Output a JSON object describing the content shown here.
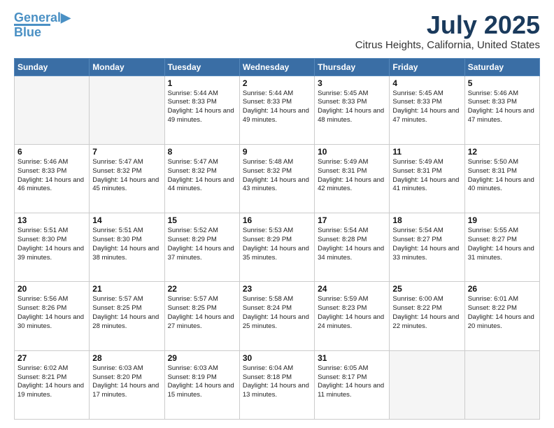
{
  "header": {
    "logo_line1": "General",
    "logo_line2": "Blue",
    "month": "July 2025",
    "location": "Citrus Heights, California, United States"
  },
  "weekdays": [
    "Sunday",
    "Monday",
    "Tuesday",
    "Wednesday",
    "Thursday",
    "Friday",
    "Saturday"
  ],
  "weeks": [
    [
      {
        "day": "",
        "info": ""
      },
      {
        "day": "",
        "info": ""
      },
      {
        "day": "1",
        "info": "Sunrise: 5:44 AM\nSunset: 8:33 PM\nDaylight: 14 hours and 49 minutes."
      },
      {
        "day": "2",
        "info": "Sunrise: 5:44 AM\nSunset: 8:33 PM\nDaylight: 14 hours and 49 minutes."
      },
      {
        "day": "3",
        "info": "Sunrise: 5:45 AM\nSunset: 8:33 PM\nDaylight: 14 hours and 48 minutes."
      },
      {
        "day": "4",
        "info": "Sunrise: 5:45 AM\nSunset: 8:33 PM\nDaylight: 14 hours and 47 minutes."
      },
      {
        "day": "5",
        "info": "Sunrise: 5:46 AM\nSunset: 8:33 PM\nDaylight: 14 hours and 47 minutes."
      }
    ],
    [
      {
        "day": "6",
        "info": "Sunrise: 5:46 AM\nSunset: 8:33 PM\nDaylight: 14 hours and 46 minutes."
      },
      {
        "day": "7",
        "info": "Sunrise: 5:47 AM\nSunset: 8:32 PM\nDaylight: 14 hours and 45 minutes."
      },
      {
        "day": "8",
        "info": "Sunrise: 5:47 AM\nSunset: 8:32 PM\nDaylight: 14 hours and 44 minutes."
      },
      {
        "day": "9",
        "info": "Sunrise: 5:48 AM\nSunset: 8:32 PM\nDaylight: 14 hours and 43 minutes."
      },
      {
        "day": "10",
        "info": "Sunrise: 5:49 AM\nSunset: 8:31 PM\nDaylight: 14 hours and 42 minutes."
      },
      {
        "day": "11",
        "info": "Sunrise: 5:49 AM\nSunset: 8:31 PM\nDaylight: 14 hours and 41 minutes."
      },
      {
        "day": "12",
        "info": "Sunrise: 5:50 AM\nSunset: 8:31 PM\nDaylight: 14 hours and 40 minutes."
      }
    ],
    [
      {
        "day": "13",
        "info": "Sunrise: 5:51 AM\nSunset: 8:30 PM\nDaylight: 14 hours and 39 minutes."
      },
      {
        "day": "14",
        "info": "Sunrise: 5:51 AM\nSunset: 8:30 PM\nDaylight: 14 hours and 38 minutes."
      },
      {
        "day": "15",
        "info": "Sunrise: 5:52 AM\nSunset: 8:29 PM\nDaylight: 14 hours and 37 minutes."
      },
      {
        "day": "16",
        "info": "Sunrise: 5:53 AM\nSunset: 8:29 PM\nDaylight: 14 hours and 35 minutes."
      },
      {
        "day": "17",
        "info": "Sunrise: 5:54 AM\nSunset: 8:28 PM\nDaylight: 14 hours and 34 minutes."
      },
      {
        "day": "18",
        "info": "Sunrise: 5:54 AM\nSunset: 8:27 PM\nDaylight: 14 hours and 33 minutes."
      },
      {
        "day": "19",
        "info": "Sunrise: 5:55 AM\nSunset: 8:27 PM\nDaylight: 14 hours and 31 minutes."
      }
    ],
    [
      {
        "day": "20",
        "info": "Sunrise: 5:56 AM\nSunset: 8:26 PM\nDaylight: 14 hours and 30 minutes."
      },
      {
        "day": "21",
        "info": "Sunrise: 5:57 AM\nSunset: 8:25 PM\nDaylight: 14 hours and 28 minutes."
      },
      {
        "day": "22",
        "info": "Sunrise: 5:57 AM\nSunset: 8:25 PM\nDaylight: 14 hours and 27 minutes."
      },
      {
        "day": "23",
        "info": "Sunrise: 5:58 AM\nSunset: 8:24 PM\nDaylight: 14 hours and 25 minutes."
      },
      {
        "day": "24",
        "info": "Sunrise: 5:59 AM\nSunset: 8:23 PM\nDaylight: 14 hours and 24 minutes."
      },
      {
        "day": "25",
        "info": "Sunrise: 6:00 AM\nSunset: 8:22 PM\nDaylight: 14 hours and 22 minutes."
      },
      {
        "day": "26",
        "info": "Sunrise: 6:01 AM\nSunset: 8:22 PM\nDaylight: 14 hours and 20 minutes."
      }
    ],
    [
      {
        "day": "27",
        "info": "Sunrise: 6:02 AM\nSunset: 8:21 PM\nDaylight: 14 hours and 19 minutes."
      },
      {
        "day": "28",
        "info": "Sunrise: 6:03 AM\nSunset: 8:20 PM\nDaylight: 14 hours and 17 minutes."
      },
      {
        "day": "29",
        "info": "Sunrise: 6:03 AM\nSunset: 8:19 PM\nDaylight: 14 hours and 15 minutes."
      },
      {
        "day": "30",
        "info": "Sunrise: 6:04 AM\nSunset: 8:18 PM\nDaylight: 14 hours and 13 minutes."
      },
      {
        "day": "31",
        "info": "Sunrise: 6:05 AM\nSunset: 8:17 PM\nDaylight: 14 hours and 11 minutes."
      },
      {
        "day": "",
        "info": ""
      },
      {
        "day": "",
        "info": ""
      }
    ]
  ]
}
